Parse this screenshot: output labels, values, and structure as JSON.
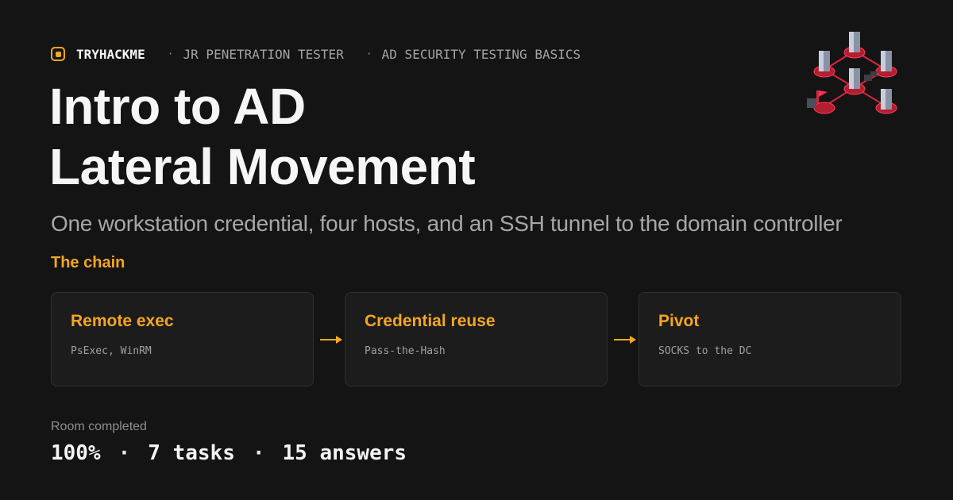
{
  "header": {
    "brand": "TRYHACKME",
    "breadcrumb_sep": "·",
    "breadcrumbs": [
      "JR PENETRATION TESTER",
      "AD SECURITY TESTING BASICS"
    ]
  },
  "title_lines": [
    "Intro to AD",
    "Lateral Movement"
  ],
  "subtitle": "One workstation credential, four hosts, and an SSH tunnel to the domain controller",
  "chain": {
    "label": "The chain",
    "steps": [
      {
        "title": "Remote exec",
        "detail": "PsExec, WinRM"
      },
      {
        "title": "Credential reuse",
        "detail": "Pass-the-Hash"
      },
      {
        "title": "Pivot",
        "detail": "SOCKS to the DC"
      }
    ]
  },
  "stats": {
    "label": "Room completed",
    "separator": "·",
    "completion": "100%",
    "tasks": "7 tasks",
    "answers": "15 answers"
  },
  "icons": {
    "logo": "tryhackme-logo-icon",
    "network": "network-servers-icon",
    "arrow": "arrow-right-icon"
  },
  "colors": {
    "accent": "#f5a623",
    "background": "#141414",
    "card": "#1c1c1c",
    "network_red": "#d7263d"
  }
}
